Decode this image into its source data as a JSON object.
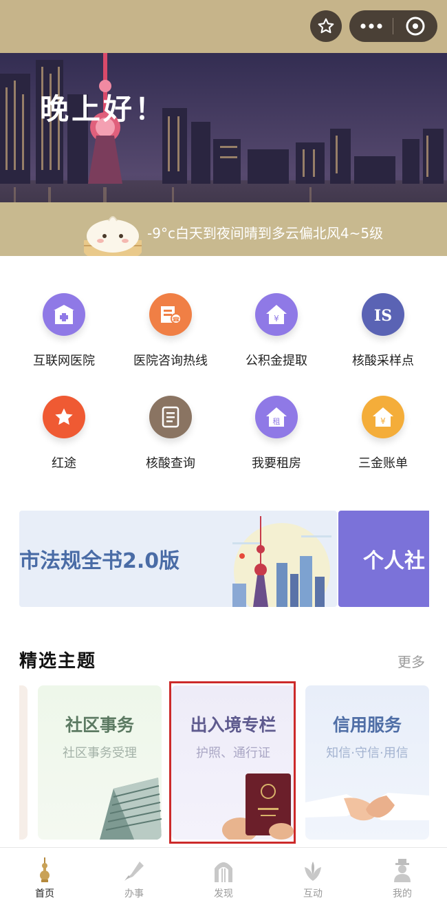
{
  "topbar": {
    "favorite_icon": "star-icon",
    "more_icon": "more-dots-icon",
    "close_icon": "close-icon",
    "bg_color": "#c6b48a"
  },
  "banner": {
    "greeting": "晚上好！",
    "weather": "-9°c白天到夜间晴到多云偏北风4~5级"
  },
  "services": [
    {
      "label": "互联网医院",
      "icon": "hospital-icon",
      "color": "#8f79e6"
    },
    {
      "label": "医院咨询热线",
      "icon": "hotline-icon",
      "color": "#f07f45"
    },
    {
      "label": "公积金提取",
      "icon": "fund-house-icon",
      "color": "#8f79e6"
    },
    {
      "label": "核酸采样点",
      "icon": "sampling-site-icon",
      "color": "#5a63b4"
    },
    {
      "label": "红途",
      "icon": "red-star-icon",
      "color": "#ef5a33"
    },
    {
      "label": "核酸查询",
      "icon": "document-icon",
      "color": "#8a7462"
    },
    {
      "label": "我要租房",
      "icon": "rent-house-icon",
      "color": "#8f79e6"
    },
    {
      "label": "三金账单",
      "icon": "bill-house-icon",
      "color": "#f4ad3a"
    }
  ],
  "promos": [
    {
      "text": "市法规全书2.0版"
    },
    {
      "text": "个人社"
    }
  ],
  "featured": {
    "title": "精选主题",
    "more": "更多",
    "cards": [
      {
        "title": "社区事务",
        "subtitle": "社区事务受理"
      },
      {
        "title": "出入境专栏",
        "subtitle": "护照、通行证"
      },
      {
        "title": "信用服务",
        "subtitle": "知信·守信·用信"
      }
    ]
  },
  "bottom_nav": [
    {
      "label": "首页",
      "icon": "home-tower-icon",
      "active": true
    },
    {
      "label": "办事",
      "icon": "pen-icon",
      "active": false
    },
    {
      "label": "发现",
      "icon": "arch-icon",
      "active": false
    },
    {
      "label": "互动",
      "icon": "flower-icon",
      "active": false
    },
    {
      "label": "我的",
      "icon": "person-icon",
      "active": false
    }
  ]
}
